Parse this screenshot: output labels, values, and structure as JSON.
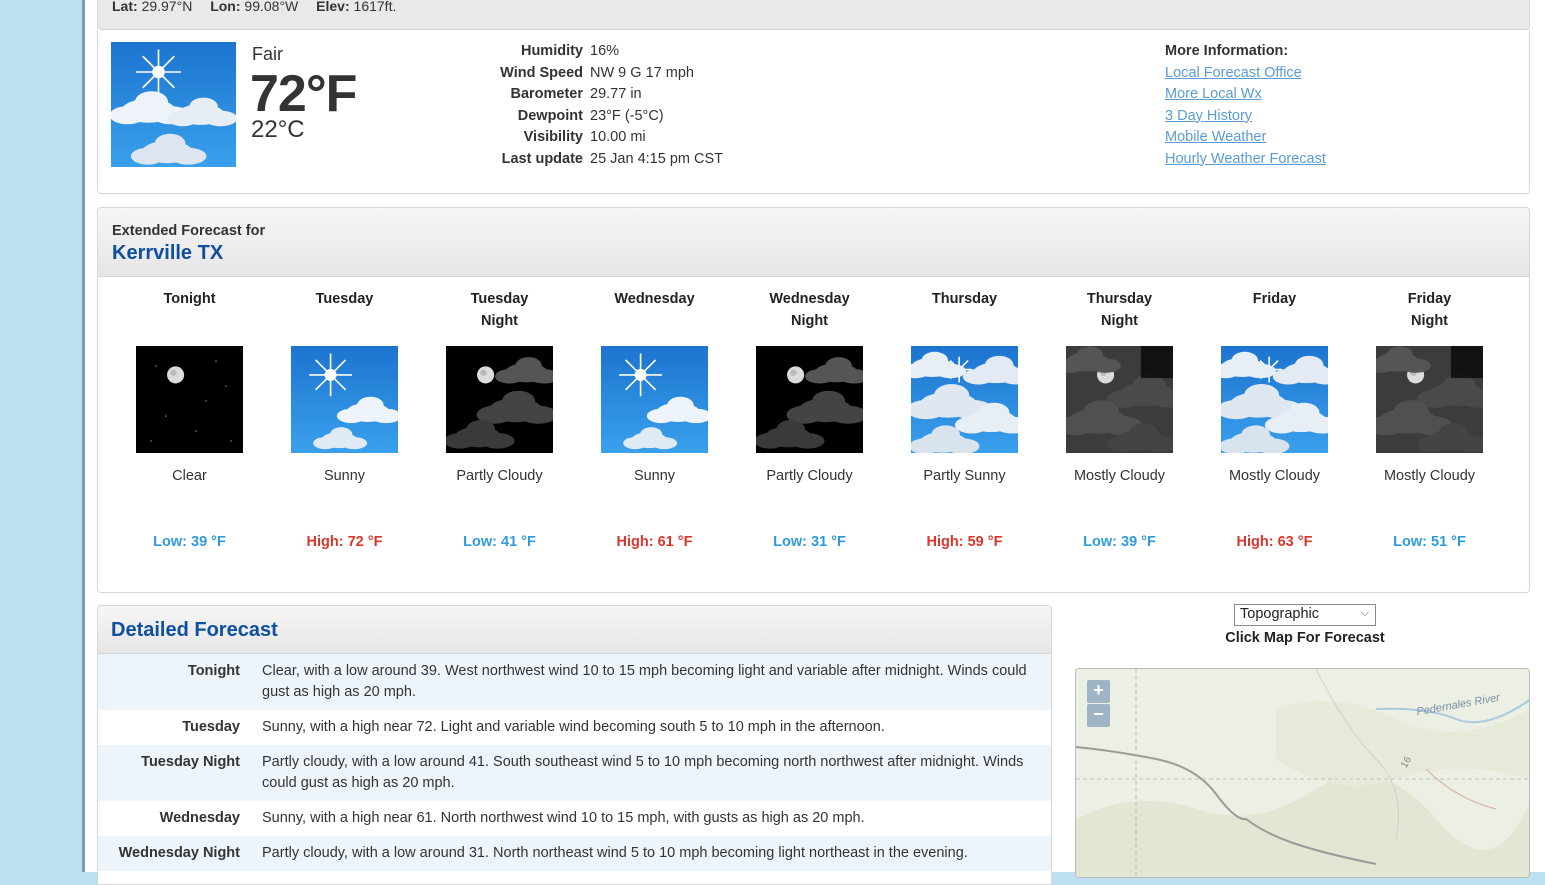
{
  "location_bar": {
    "lat_label": "Lat:",
    "lat_value": "29.97°N",
    "lon_label": "Lon:",
    "lon_value": "99.08°W",
    "elev_label": "Elev:",
    "elev_value": "1617ft."
  },
  "current": {
    "summary": "Fair",
    "temp_f": "72°F",
    "temp_c": "22°C",
    "details": [
      {
        "label": "Humidity",
        "value": "16%"
      },
      {
        "label": "Wind Speed",
        "value": "NW 9 G 17 mph"
      },
      {
        "label": "Barometer",
        "value": "29.77 in"
      },
      {
        "label": "Dewpoint",
        "value": "23°F (-5°C)"
      },
      {
        "label": "Visibility",
        "value": "10.00 mi"
      },
      {
        "label": "Last update",
        "value": "25 Jan 4:15 pm CST"
      }
    ],
    "more_info_title": "More Information:",
    "more_info_links": [
      "Local Forecast Office",
      "More Local Wx",
      "3 Day History",
      "Mobile Weather",
      "Hourly Weather Forecast"
    ]
  },
  "extended": {
    "label": "Extended Forecast for",
    "location": "Kerrville TX",
    "periods": [
      {
        "line1": "Tonight",
        "line2": "",
        "icon": "night-clear-icon",
        "short": "Clear",
        "temp": "Low: 39 °F",
        "kind": "low"
      },
      {
        "line1": "Tuesday",
        "line2": "",
        "icon": "sunny-icon",
        "short": "Sunny",
        "temp": "High: 72 °F",
        "kind": "high"
      },
      {
        "line1": "Tuesday",
        "line2": "Night",
        "icon": "night-partly-cloudy-icon",
        "short": "Partly Cloudy",
        "temp": "Low: 41 °F",
        "kind": "low"
      },
      {
        "line1": "Wednesday",
        "line2": "",
        "icon": "sunny-icon",
        "short": "Sunny",
        "temp": "High: 61 °F",
        "kind": "high"
      },
      {
        "line1": "Wednesday",
        "line2": "Night",
        "icon": "night-partly-cloudy-icon",
        "short": "Partly Cloudy",
        "temp": "Low: 31 °F",
        "kind": "low"
      },
      {
        "line1": "Thursday",
        "line2": "",
        "icon": "partly-sunny-icon",
        "short": "Partly Sunny",
        "temp": "High: 59 °F",
        "kind": "high"
      },
      {
        "line1": "Thursday",
        "line2": "Night",
        "icon": "night-mostly-cloudy-icon",
        "short": "Mostly Cloudy",
        "temp": "Low: 39 °F",
        "kind": "low"
      },
      {
        "line1": "Friday",
        "line2": "",
        "icon": "mostly-cloudy-day-icon",
        "short": "Mostly Cloudy",
        "temp": "High: 63 °F",
        "kind": "high"
      },
      {
        "line1": "Friday",
        "line2": "Night",
        "icon": "night-mostly-cloudy-icon",
        "short": "Mostly Cloudy",
        "temp": "Low: 51 °F",
        "kind": "low"
      }
    ],
    "colors": {
      "low": "#2e9bde",
      "high": "#d9372b"
    }
  },
  "detailed": {
    "title": "Detailed Forecast",
    "rows": [
      {
        "label": "Tonight",
        "text": "Clear, with a low around 39. West northwest wind 10 to 15 mph becoming light and variable after midnight. Winds could gust as high as 20 mph."
      },
      {
        "label": "Tuesday",
        "text": "Sunny, with a high near 72. Light and variable wind becoming south 5 to 10 mph in the afternoon."
      },
      {
        "label": "Tuesday Night",
        "text": "Partly cloudy, with a low around 41. South southeast wind 5 to 10 mph becoming north northwest after midnight. Winds could gust as high as 20 mph."
      },
      {
        "label": "Wednesday",
        "text": "Sunny, with a high near 61. North northwest wind 10 to 15 mph, with gusts as high as 20 mph."
      },
      {
        "label": "Wednesday Night",
        "text": "Partly cloudy, with a low around 31. North northeast wind 5 to 10 mph becoming light northeast in the evening."
      }
    ]
  },
  "map": {
    "select_value": "Topographic",
    "caption": "Click Map For Forecast",
    "zoom_in": "+",
    "zoom_out": "−",
    "river_label": "Pedernales River",
    "road_label": "16"
  }
}
